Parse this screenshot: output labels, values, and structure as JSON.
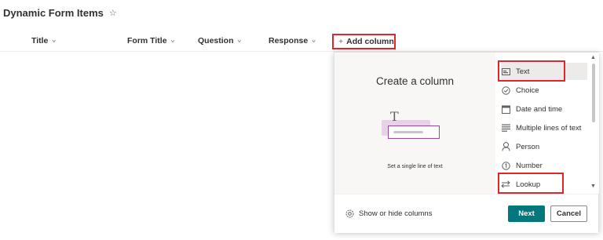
{
  "page": {
    "title": "Dynamic Form Items",
    "favorite_icon": "star-icon"
  },
  "columns": [
    {
      "label": "Title"
    },
    {
      "label": "Form Title"
    },
    {
      "label": "Question"
    },
    {
      "label": "Response"
    }
  ],
  "add_column": {
    "icon": "+",
    "label": "Add column"
  },
  "panel": {
    "title": "Create a column",
    "illustration_glyph": "T",
    "description": "Set a single line of text",
    "options": [
      {
        "label": "Text",
        "icon": "text-icon",
        "selected": true
      },
      {
        "label": "Choice",
        "icon": "choice-icon"
      },
      {
        "label": "Date and time",
        "icon": "calendar-icon"
      },
      {
        "label": "Multiple lines of text",
        "icon": "multiline-icon"
      },
      {
        "label": "Person",
        "icon": "person-icon"
      },
      {
        "label": "Number",
        "icon": "number-icon"
      },
      {
        "label": "Lookup",
        "icon": "lookup-icon"
      }
    ],
    "footer": {
      "show_hide_label": "Show or hide columns",
      "next_label": "Next",
      "cancel_label": "Cancel"
    }
  },
  "colors": {
    "accent": "#03787c",
    "highlight": "#e0252b",
    "illustration": "#e6d3e6"
  }
}
